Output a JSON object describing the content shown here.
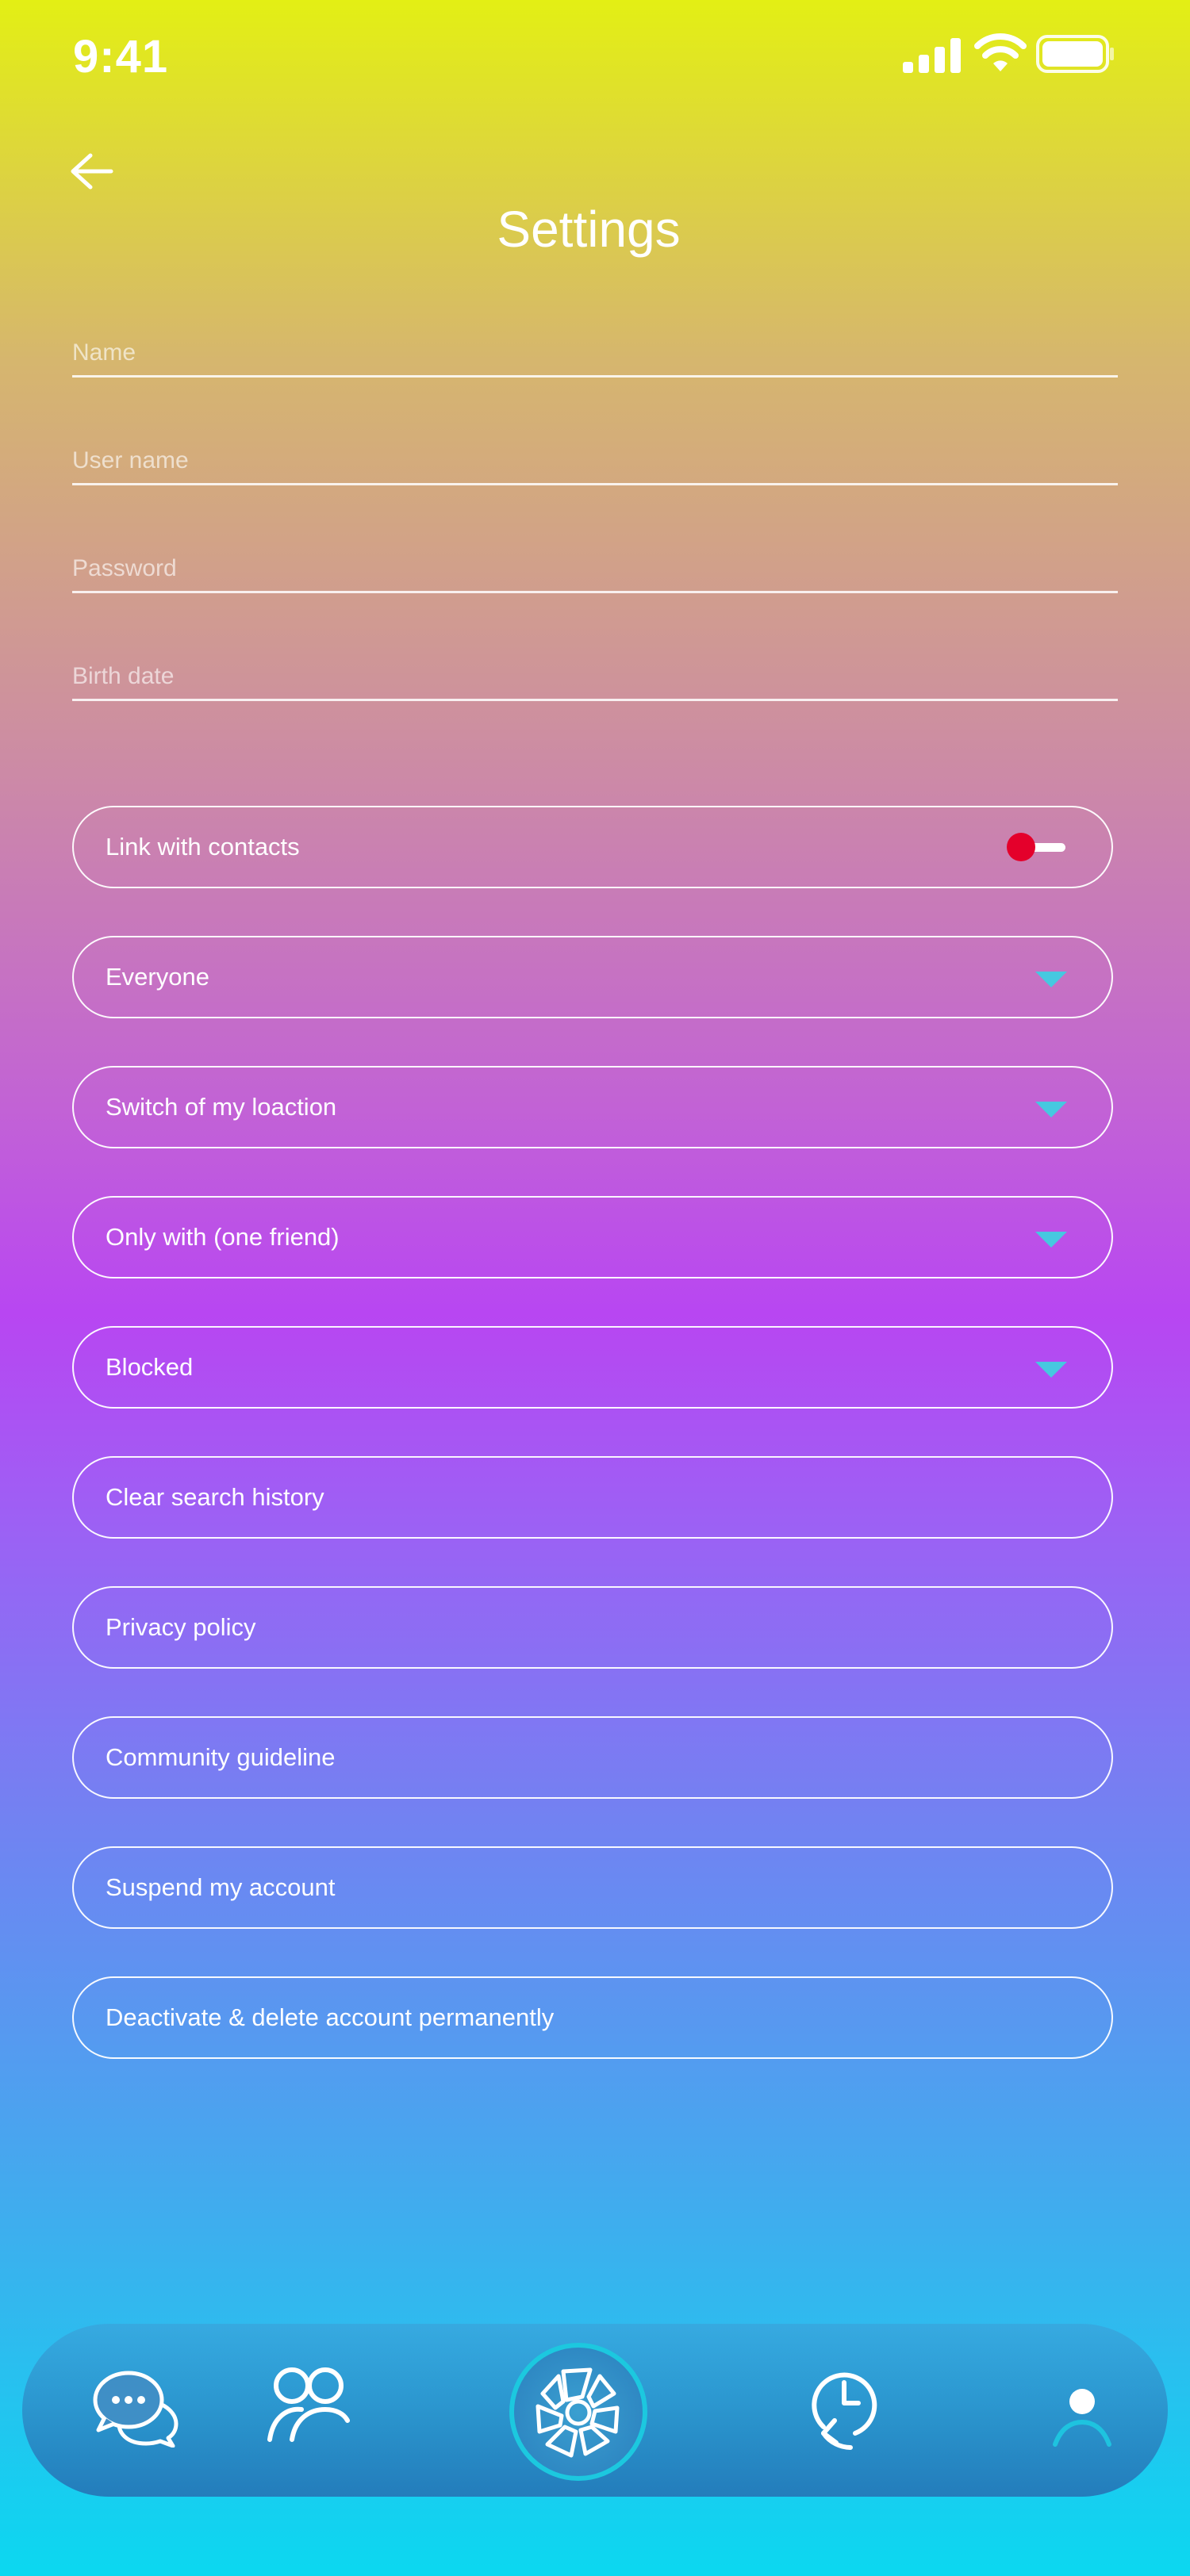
{
  "status": {
    "time": "9:41"
  },
  "header": {
    "title": "Settings"
  },
  "fields": [
    {
      "placeholder": "Name"
    },
    {
      "placeholder": "User name"
    },
    {
      "placeholder": "Password"
    },
    {
      "placeholder": "Birth date"
    }
  ],
  "settings": [
    {
      "label": "Link with contacts",
      "control": "toggle",
      "toggle_on": false
    },
    {
      "label": "Everyone",
      "control": "dropdown"
    },
    {
      "label": "Switch of my loaction",
      "control": "dropdown"
    },
    {
      "label": "Only with (one friend)",
      "control": "dropdown"
    },
    {
      "label": "Blocked",
      "control": "dropdown"
    },
    {
      "label": "Clear search history",
      "control": "none"
    },
    {
      "label": "Privacy policy",
      "control": "none"
    },
    {
      "label": "Community guideline",
      "control": "none"
    },
    {
      "label": "Suspend my account",
      "control": "none"
    },
    {
      "label": "Deactivate & delete account permanently",
      "control": "none"
    }
  ],
  "tabbar": {
    "items": [
      {
        "icon": "chat-bubbles-icon"
      },
      {
        "icon": "friends-icon"
      },
      {
        "icon": "camera-shutter-icon"
      },
      {
        "icon": "history-clock-icon"
      },
      {
        "icon": "profile-icon"
      }
    ]
  },
  "colors": {
    "toggle_knob": "#e4002b",
    "caret": "#46c8e0",
    "center_ring": "#1cc8df"
  }
}
